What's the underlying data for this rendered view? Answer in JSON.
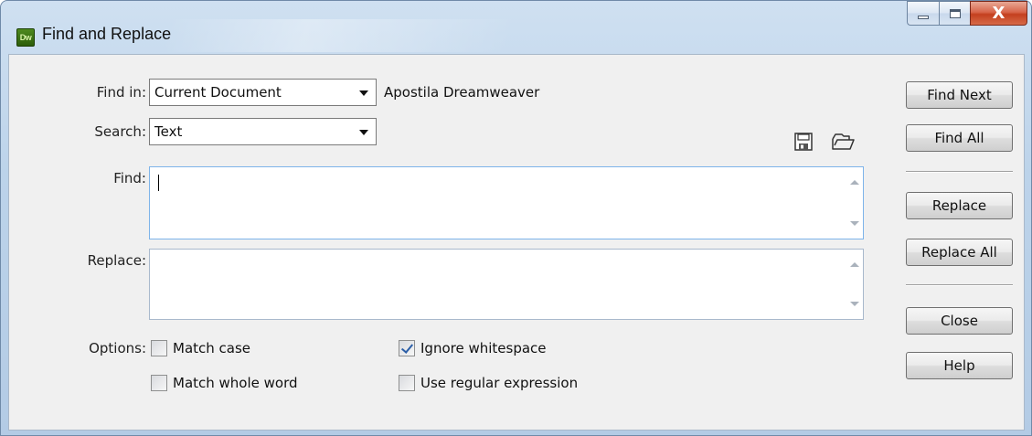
{
  "window": {
    "app_badge": "Dw",
    "title": "Find and Replace",
    "controls": {
      "minimize": "minimize",
      "maximize": "maximize",
      "close": "X"
    }
  },
  "form": {
    "find_in": {
      "label": "Find in:",
      "value": "Current Document",
      "context": "Apostila Dreamweaver"
    },
    "search": {
      "label": "Search:",
      "value": "Text"
    },
    "find": {
      "label": "Find:",
      "value": ""
    },
    "replace": {
      "label": "Replace:",
      "value": ""
    },
    "options": {
      "label": "Options:",
      "match_case": {
        "label": "Match case",
        "checked": false
      },
      "match_whole_word": {
        "label": "Match whole word",
        "checked": false
      },
      "ignore_whitespace": {
        "label": "Ignore whitespace",
        "checked": true
      },
      "use_regex": {
        "label": "Use regular expression",
        "checked": false
      }
    },
    "icons": {
      "save": "save-query-icon",
      "load": "load-query-icon"
    }
  },
  "buttons": {
    "find_next": "Find Next",
    "find_all": "Find All",
    "replace": "Replace",
    "replace_all": "Replace All",
    "close": "Close",
    "help": "Help"
  }
}
